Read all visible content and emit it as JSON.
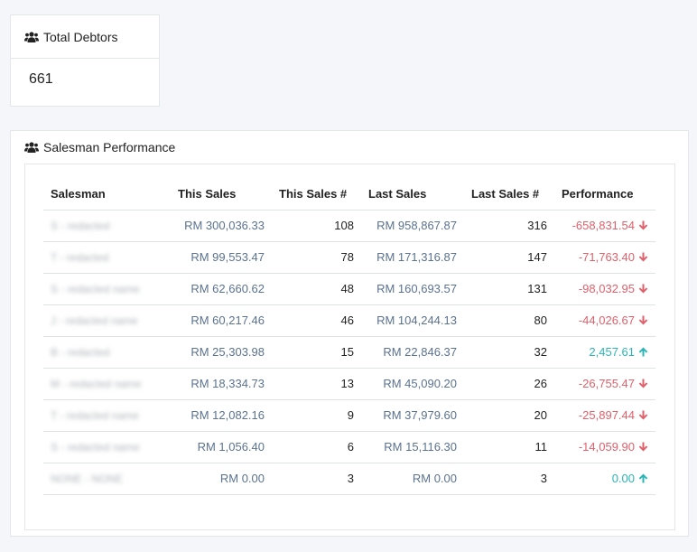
{
  "total_debtors": {
    "title": "Total Debtors",
    "value": "661",
    "icon": "users-icon"
  },
  "salesman_performance": {
    "title": "Salesman Performance",
    "icon": "users-icon",
    "columns": [
      "Salesman",
      "This Sales",
      "This Sales #",
      "Last Sales",
      "Last Sales #",
      "Performance"
    ],
    "rows": [
      {
        "salesman": "S - redacted",
        "this_sales": "RM 300,036.33",
        "this_count": "108",
        "last_sales": "RM 958,867.87",
        "last_count": "316",
        "performance": "-658,831.54",
        "trend": "down"
      },
      {
        "salesman": "T - redacted",
        "this_sales": "RM 99,553.47",
        "this_count": "78",
        "last_sales": "RM 171,316.87",
        "last_count": "147",
        "performance": "-71,763.40",
        "trend": "down"
      },
      {
        "salesman": "S - redacted name",
        "this_sales": "RM 62,660.62",
        "this_count": "48",
        "last_sales": "RM 160,693.57",
        "last_count": "131",
        "performance": "-98,032.95",
        "trend": "down"
      },
      {
        "salesman": "J - redacted name",
        "this_sales": "RM 60,217.46",
        "this_count": "46",
        "last_sales": "RM 104,244.13",
        "last_count": "80",
        "performance": "-44,026.67",
        "trend": "down"
      },
      {
        "salesman": "B - redacted",
        "this_sales": "RM 25,303.98",
        "this_count": "15",
        "last_sales": "RM 22,846.37",
        "last_count": "32",
        "performance": "2,457.61",
        "trend": "up"
      },
      {
        "salesman": "M - redacted name",
        "this_sales": "RM 18,334.73",
        "this_count": "13",
        "last_sales": "RM 45,090.20",
        "last_count": "26",
        "performance": "-26,755.47",
        "trend": "down"
      },
      {
        "salesman": "T - redacted name",
        "this_sales": "RM 12,082.16",
        "this_count": "9",
        "last_sales": "RM 37,979.60",
        "last_count": "20",
        "performance": "-25,897.44",
        "trend": "down"
      },
      {
        "salesman": "S - redacted name",
        "this_sales": "RM 1,056.40",
        "this_count": "6",
        "last_sales": "RM 15,116.30",
        "last_count": "11",
        "performance": "-14,059.90",
        "trend": "down"
      },
      {
        "salesman": "NONE - NONE",
        "this_sales": "RM 0.00",
        "this_count": "3",
        "last_sales": "RM 0.00",
        "last_count": "3",
        "performance": "0.00",
        "trend": "up"
      }
    ]
  },
  "colors": {
    "negative": "#e0606b",
    "positive": "#2bb5b8",
    "money": "#5b7290",
    "background": "#f4f6f9"
  }
}
